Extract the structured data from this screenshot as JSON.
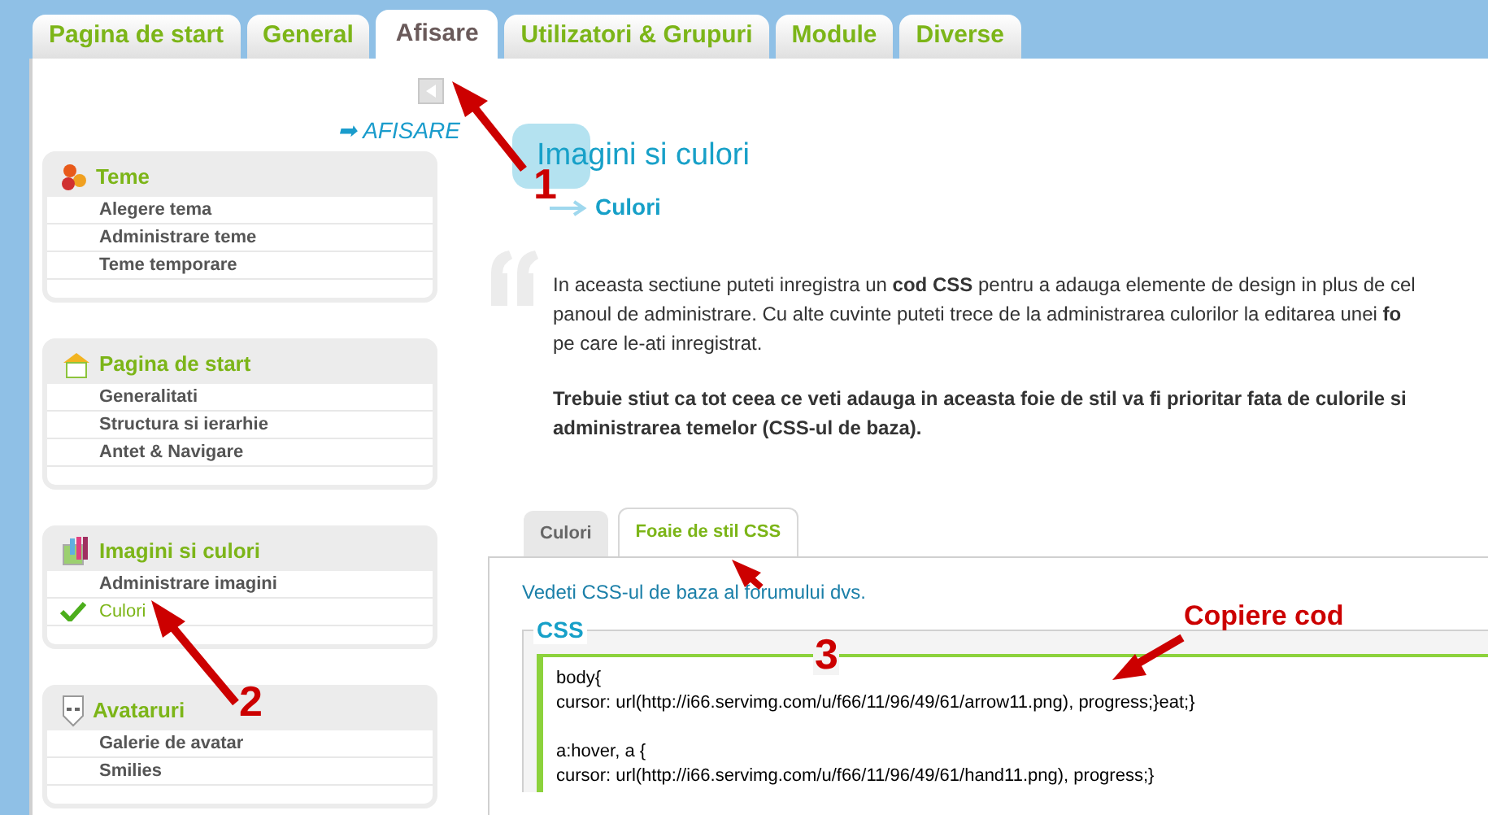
{
  "tabs": [
    {
      "label": "Pagina de start",
      "selected": false
    },
    {
      "label": "General",
      "selected": false
    },
    {
      "label": "Afisare",
      "selected": true
    },
    {
      "label": "Utilizatori & Grupuri",
      "selected": false
    },
    {
      "label": "Module",
      "selected": false
    },
    {
      "label": "Diverse",
      "selected": false
    }
  ],
  "section_link": "➡ AFISARE",
  "sidebar": {
    "groups": [
      {
        "title": "Teme",
        "items": [
          {
            "label": "Alegere tema",
            "selected": false
          },
          {
            "label": "Administrare teme",
            "selected": false
          },
          {
            "label": "Teme temporare",
            "selected": false
          }
        ]
      },
      {
        "title": "Pagina de start",
        "items": [
          {
            "label": "Generalitati",
            "selected": false
          },
          {
            "label": "Structura si ierarhie",
            "selected": false
          },
          {
            "label": "Antet & Navigare",
            "selected": false
          }
        ]
      },
      {
        "title": "Imagini si culori",
        "items": [
          {
            "label": "Administrare imagini",
            "selected": false
          },
          {
            "label": "Culori",
            "selected": true
          }
        ]
      },
      {
        "title": "Avataruri",
        "items": [
          {
            "label": "Galerie de avatar",
            "selected": false
          },
          {
            "label": "Smilies",
            "selected": false
          }
        ]
      }
    ]
  },
  "header": {
    "title": "Imagini si culori",
    "breadcrumb": "Culori"
  },
  "intro": [
    {
      "kind": "normal",
      "lines": [
        "In aceasta sectiune puteti inregistra un **cod CSS** pentru a adauga elemente de design in plus de cel",
        "panoul de administrare. Cu alte cuvinte puteti trece de la administrarea culorilor la editarea unei **fo**",
        "pe care le-ati inregistrat."
      ]
    },
    {
      "kind": "bold",
      "lines": [
        "Trebuie stiut ca tot ceea ce veti adauga in aceasta foie de stil va fi prioritar fata de culorile si",
        "administrarea temelor (CSS-ul de baza)."
      ]
    }
  ],
  "subtabs": [
    {
      "label": "Culori",
      "selected": false
    },
    {
      "label": "Foaie de stil CSS",
      "selected": true
    }
  ],
  "base_css_link": "Vedeti CSS-ul de baza al forumului dvs.",
  "css_box": {
    "legend": "CSS",
    "code": [
      [
        "body{",
        "cursor: url(http://i66.servimg.com/u/f66/11/96/49/61/arrow11.png), progress;}eat;}"
      ],
      [
        "a:hover, a {",
        "cursor: url(http://i66.servimg.com/u/f66/11/96/49/61/hand11.png), progress;}"
      ]
    ]
  },
  "annotations": [
    {
      "label": "1"
    },
    {
      "label": "2"
    },
    {
      "label": "3"
    },
    {
      "label": "Copiere cod"
    }
  ]
}
